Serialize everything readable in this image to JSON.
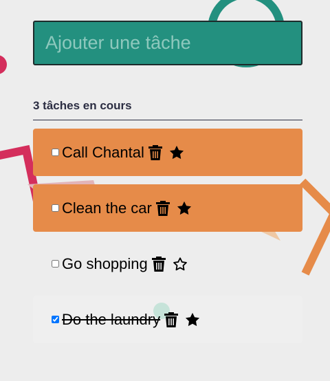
{
  "input": {
    "placeholder": "Ajouter une tâche",
    "value": ""
  },
  "summary": {
    "count_text": "3 tâches en cours"
  },
  "colors": {
    "input_bg": "#23907f",
    "starred_row": "#e68b49",
    "heading": "#2b2d42"
  },
  "tasks": [
    {
      "label": "Call Chantal",
      "done": false,
      "starred": true,
      "delete_icon": "trash-icon",
      "star_icon": "star-filled-icon"
    },
    {
      "label": "Clean the car",
      "done": false,
      "starred": true,
      "delete_icon": "trash-icon",
      "star_icon": "star-filled-icon"
    },
    {
      "label": "Go shopping",
      "done": false,
      "starred": false,
      "delete_icon": "trash-icon",
      "star_icon": "star-outline-icon"
    },
    {
      "label": "Do the laundry",
      "done": true,
      "starred": true,
      "delete_icon": "trash-icon",
      "star_icon": "star-filled-icon"
    }
  ]
}
